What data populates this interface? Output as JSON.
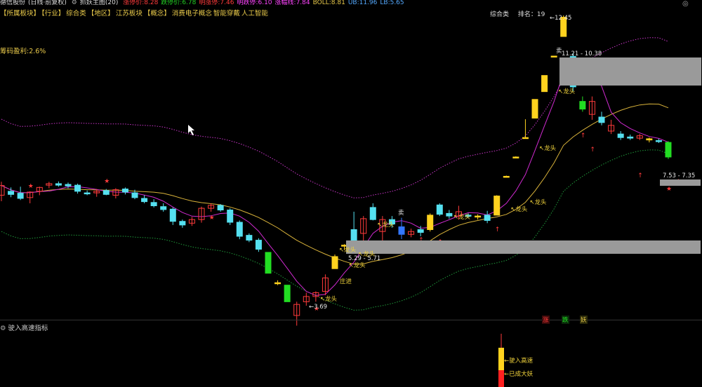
{
  "topbar": {
    "stock": "德信股份",
    "mode": "(日线·前复权)",
    "indicator": "抓妖主图(20)",
    "items": [
      {
        "label": "涨停价:",
        "value": "8.28",
        "color": "#ff3b3b"
      },
      {
        "label": "跌停价:",
        "value": "6.78",
        "color": "#22cc22"
      },
      {
        "label": "明涨停:",
        "value": "7.46",
        "color": "#ff3b3b"
      },
      {
        "label": "明跌停:",
        "value": "6.10",
        "color": "#ff44ff"
      },
      {
        "label": "涨幅线:",
        "value": "7.84",
        "color": "#ff44ff"
      },
      {
        "label": "BOLL:",
        "value": "8.81",
        "color": "#e8c94a"
      },
      {
        "label": "UB:",
        "value": "11.96",
        "color": "#55aaff"
      },
      {
        "label": "LB:",
        "value": "5.65",
        "color": "#55aaff"
      }
    ]
  },
  "sectors": [
    "【所属板块】",
    "【行业】",
    "综合类",
    "【地区】",
    "江苏板块",
    "【概念】",
    "消费电子概念",
    "智能穿戴",
    "人工智能"
  ],
  "profit_text": "筹码盈利:2.6%",
  "rank": {
    "industry": "综合类",
    "rank_label": "排名：",
    "rank_value": "19"
  },
  "close_icon": "◎",
  "subchart_title": "驶入高速指标",
  "annotations": {
    "high_price": "12.45",
    "high_range": "11.21 - 10.38",
    "mid_range": "5.29 - 5.71",
    "right_range": "7.53 - 7.35",
    "low_price": "3.69",
    "dragon_head": "龙头",
    "sell": "卖",
    "zhuangjin": "庄进",
    "zhang": "涨",
    "die": "跌",
    "yao": "妖"
  },
  "subchart_labels": {
    "highway": "驶入高速",
    "demon": "已成大妖"
  },
  "colors": {
    "up": "#ff3b3b",
    "down": "#55e0f0",
    "limit_up": "#ffd21e",
    "limit_down": "#22dd22",
    "ma_yellow": "#d8b23a",
    "ma_magenta": "#d02ad0",
    "band_upper": "#c835c8",
    "band_lower": "#1f9a3a",
    "box_gray": "#9a9a9a"
  },
  "candles": [
    {
      "o": 5.2,
      "h": 5.55,
      "l": 5.05,
      "c": 5.45,
      "t": "up"
    },
    {
      "o": 5.3,
      "h": 5.4,
      "l": 5.15,
      "c": 5.22,
      "t": "down"
    },
    {
      "o": 5.25,
      "h": 5.42,
      "l": 5.08,
      "c": 5.12,
      "t": "down"
    },
    {
      "o": 5.14,
      "h": 5.3,
      "l": 5.0,
      "c": 5.28,
      "t": "up"
    },
    {
      "o": 5.3,
      "h": 5.42,
      "l": 5.2,
      "c": 5.4,
      "t": "up"
    },
    {
      "o": 5.46,
      "h": 5.55,
      "l": 5.38,
      "c": 5.5,
      "t": "up"
    },
    {
      "o": 5.5,
      "h": 5.56,
      "l": 5.42,
      "c": 5.46,
      "t": "down"
    },
    {
      "o": 5.48,
      "h": 5.53,
      "l": 5.38,
      "c": 5.44,
      "t": "down"
    },
    {
      "o": 5.46,
      "h": 5.5,
      "l": 5.24,
      "c": 5.3,
      "t": "down"
    },
    {
      "o": 5.26,
      "h": 5.32,
      "l": 5.2,
      "c": 5.24,
      "t": "down"
    },
    {
      "o": 5.26,
      "h": 5.36,
      "l": 5.16,
      "c": 5.3,
      "t": "up"
    },
    {
      "o": 5.32,
      "h": 5.36,
      "l": 5.2,
      "c": 5.22,
      "t": "down"
    },
    {
      "o": 5.2,
      "h": 5.38,
      "l": 5.12,
      "c": 5.34,
      "t": "up"
    },
    {
      "o": 5.36,
      "h": 5.4,
      "l": 5.22,
      "c": 5.28,
      "t": "down"
    },
    {
      "o": 5.26,
      "h": 5.34,
      "l": 5.1,
      "c": 5.14,
      "t": "down"
    },
    {
      "o": 5.12,
      "h": 5.2,
      "l": 5.0,
      "c": 5.04,
      "t": "down"
    },
    {
      "o": 5.02,
      "h": 5.1,
      "l": 4.9,
      "c": 4.94,
      "t": "down"
    },
    {
      "o": 4.92,
      "h": 5.0,
      "l": 4.8,
      "c": 4.85,
      "t": "down"
    },
    {
      "o": 4.86,
      "h": 4.9,
      "l": 4.5,
      "c": 4.58,
      "t": "down"
    },
    {
      "o": 4.58,
      "h": 4.62,
      "l": 4.44,
      "c": 4.5,
      "t": "down"
    },
    {
      "o": 4.54,
      "h": 4.68,
      "l": 4.48,
      "c": 4.62,
      "t": "up"
    },
    {
      "o": 4.62,
      "h": 4.92,
      "l": 4.55,
      "c": 4.88,
      "t": "up"
    },
    {
      "o": 4.88,
      "h": 5.0,
      "l": 4.8,
      "c": 4.95,
      "t": "up"
    },
    {
      "o": 4.95,
      "h": 4.98,
      "l": 4.8,
      "c": 4.84,
      "t": "down"
    },
    {
      "o": 4.84,
      "h": 4.88,
      "l": 4.5,
      "c": 4.56,
      "t": "down"
    },
    {
      "o": 4.56,
      "h": 4.6,
      "l": 4.2,
      "c": 4.26,
      "t": "down"
    },
    {
      "o": 4.28,
      "h": 4.32,
      "l": 4.14,
      "c": 4.18,
      "t": "down"
    },
    {
      "o": 4.18,
      "h": 4.22,
      "l": 3.95,
      "c": 4.0,
      "t": "down"
    },
    {
      "o": 3.94,
      "h": 3.94,
      "l": 3.56,
      "c": 3.56,
      "t": "limitdown"
    },
    {
      "o": 3.4,
      "h": 3.44,
      "l": 3.36,
      "c": 3.4,
      "t": "doji"
    },
    {
      "o": 3.36,
      "h": 3.36,
      "l": 3.1,
      "c": 3.1,
      "t": "limitdown"
    },
    {
      "o": 2.9,
      "h": 3.1,
      "l": 2.76,
      "c": 3.06,
      "t": "up"
    },
    {
      "o": 3.1,
      "h": 3.24,
      "l": 3.04,
      "c": 3.18,
      "t": "up"
    },
    {
      "o": 3.18,
      "h": 3.26,
      "l": 3.1,
      "c": 3.24,
      "t": "up"
    },
    {
      "o": 3.26,
      "h": 3.54,
      "l": 3.2,
      "c": 3.48,
      "t": "up"
    },
    {
      "o": 3.64,
      "h": 3.9,
      "l": 3.64,
      "c": 3.86,
      "t": "limitup"
    },
    {
      "o": 4.08,
      "h": 4.1,
      "l": 3.98,
      "c": 4.08,
      "t": "doji"
    },
    {
      "o": 4.4,
      "h": 4.8,
      "l": 4.08,
      "c": 4.12,
      "t": "down"
    },
    {
      "o": 4.32,
      "h": 4.7,
      "l": 4.1,
      "c": 4.64,
      "t": "up"
    },
    {
      "o": 4.62,
      "h": 5.0,
      "l": 4.6,
      "c": 4.9,
      "t": "down"
    },
    {
      "o": 4.36,
      "h": 4.7,
      "l": 4.0,
      "c": 4.62,
      "t": "up"
    },
    {
      "o": 4.62,
      "h": 4.7,
      "l": 4.44,
      "c": 4.52,
      "t": "down"
    },
    {
      "o": 4.46,
      "h": 4.66,
      "l": 4.2,
      "c": 4.3,
      "t": "limitdown2"
    },
    {
      "o": 4.3,
      "h": 4.42,
      "l": 4.24,
      "c": 4.36,
      "t": "up"
    },
    {
      "o": 4.4,
      "h": 4.48,
      "l": 4.26,
      "c": 4.34,
      "t": "down"
    },
    {
      "o": 4.4,
      "h": 4.76,
      "l": 4.36,
      "c": 4.72,
      "t": "limitup"
    },
    {
      "o": 4.74,
      "h": 5.0,
      "l": 4.7,
      "c": 4.96,
      "t": "down"
    },
    {
      "o": 4.76,
      "h": 4.84,
      "l": 4.64,
      "c": 4.7,
      "t": "down"
    },
    {
      "o": 4.7,
      "h": 4.94,
      "l": 4.62,
      "c": 4.8,
      "t": "up"
    },
    {
      "o": 4.72,
      "h": 4.76,
      "l": 4.66,
      "c": 4.7,
      "t": "down"
    },
    {
      "o": 4.68,
      "h": 4.74,
      "l": 4.62,
      "c": 4.7,
      "t": "doji"
    },
    {
      "o": 4.6,
      "h": 4.82,
      "l": 4.54,
      "c": 4.72,
      "t": "down"
    },
    {
      "o": 4.72,
      "h": 5.2,
      "l": 4.72,
      "c": 5.18,
      "t": "limitup"
    },
    {
      "o": 5.7,
      "h": 5.72,
      "l": 5.68,
      "c": 5.7,
      "t": "doji"
    },
    {
      "o": 6.26,
      "h": 6.28,
      "l": 6.24,
      "c": 6.26,
      "t": "limitup"
    },
    {
      "o": 6.88,
      "h": 7.52,
      "l": 6.88,
      "c": 6.88,
      "t": "doji"
    },
    {
      "o": 7.56,
      "h": 8.28,
      "l": 7.56,
      "c": 8.28,
      "t": "limitup"
    },
    {
      "o": 8.6,
      "h": 9.3,
      "l": 8.6,
      "c": 9.3,
      "t": "limitup"
    },
    {
      "o": 10.22,
      "h": 10.22,
      "l": 10.22,
      "c": 10.22,
      "t": "limitup"
    },
    {
      "o": 11.24,
      "h": 12.45,
      "l": 11.24,
      "c": 12.34,
      "t": "limitup"
    },
    {
      "o": 10.2,
      "h": 10.38,
      "l": 8.6,
      "c": 8.8,
      "t": "down"
    },
    {
      "o": 8.2,
      "h": 8.4,
      "l": 7.8,
      "c": 7.9,
      "t": "limitdown"
    },
    {
      "o": 8.2,
      "h": 8.4,
      "l": 7.5,
      "c": 7.7,
      "t": "up"
    },
    {
      "o": 7.6,
      "h": 7.8,
      "l": 7.3,
      "c": 7.4,
      "t": "down"
    },
    {
      "o": 7.3,
      "h": 7.5,
      "l": 7.0,
      "c": 7.1,
      "t": "up"
    },
    {
      "o": 7.0,
      "h": 7.1,
      "l": 6.8,
      "c": 6.88,
      "t": "down"
    },
    {
      "o": 6.9,
      "h": 6.98,
      "l": 6.8,
      "c": 6.86,
      "t": "down"
    },
    {
      "o": 6.86,
      "h": 7.0,
      "l": 6.8,
      "c": 6.94,
      "t": "up"
    },
    {
      "o": 6.84,
      "h": 6.88,
      "l": 6.72,
      "c": 6.8,
      "t": "doji"
    },
    {
      "o": 6.76,
      "h": 6.84,
      "l": 6.7,
      "c": 6.78,
      "t": "down"
    },
    {
      "o": 6.72,
      "h": 6.76,
      "l": 6.2,
      "c": 6.26,
      "t": "limitdown"
    }
  ]
}
